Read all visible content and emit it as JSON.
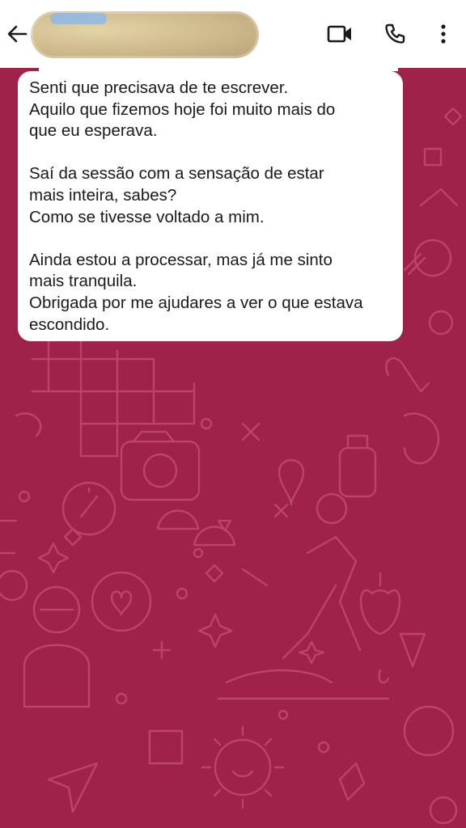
{
  "header": {
    "contact_name": "",
    "icons": {
      "back": "arrow-left-icon",
      "video": "video-camera-icon",
      "call": "phone-icon",
      "menu": "more-vertical-icon"
    }
  },
  "message": {
    "paragraphs": [
      [
        "Senti que precisava de te escrever.",
        "Aquilo que fizemos hoje foi muito mais do",
        "que eu esperava."
      ],
      [
        "Saí da sessão com a sensação de estar",
        "mais inteira, sabes?",
        "Como se tivesse voltado a mim."
      ],
      [
        "Ainda estou a processar, mas já me sinto",
        "mais tranquila.",
        "Obrigada por me ajudares a ver o que estava",
        "escondido."
      ]
    ]
  },
  "colors": {
    "wallpaper": "#9e2249",
    "doodle": "#c04a6e",
    "bubble": "#ffffff",
    "header": "#ffffff"
  }
}
